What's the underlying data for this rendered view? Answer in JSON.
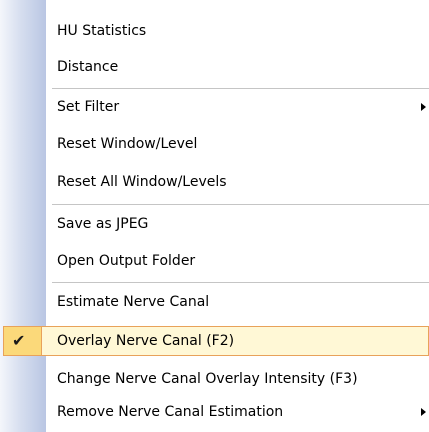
{
  "menu": {
    "items": [
      {
        "label": "HU Statistics"
      },
      {
        "label": "Distance"
      },
      {
        "label": "Set Filter",
        "submenu": true
      },
      {
        "label": "Reset Window/Level"
      },
      {
        "label": "Reset All Window/Levels"
      },
      {
        "label": "Save as JPEG"
      },
      {
        "label": "Open Output Folder"
      },
      {
        "label": "Estimate Nerve Canal"
      },
      {
        "label": "Overlay Nerve Canal (F2)",
        "checked": true,
        "check_icon": "checkmark-icon"
      },
      {
        "label": "Change Nerve Canal Overlay Intensity (F3)"
      },
      {
        "label": "Remove Nerve Canal Estimation",
        "submenu": true
      }
    ],
    "colors": {
      "gutter_gradient_start": "#f4f6fb",
      "gutter_gradient_end": "#b9c6e3",
      "highlight_background": "#fff8d6",
      "highlight_border": "#e8a25a",
      "checkbox_fill": "#fbd97a"
    }
  }
}
